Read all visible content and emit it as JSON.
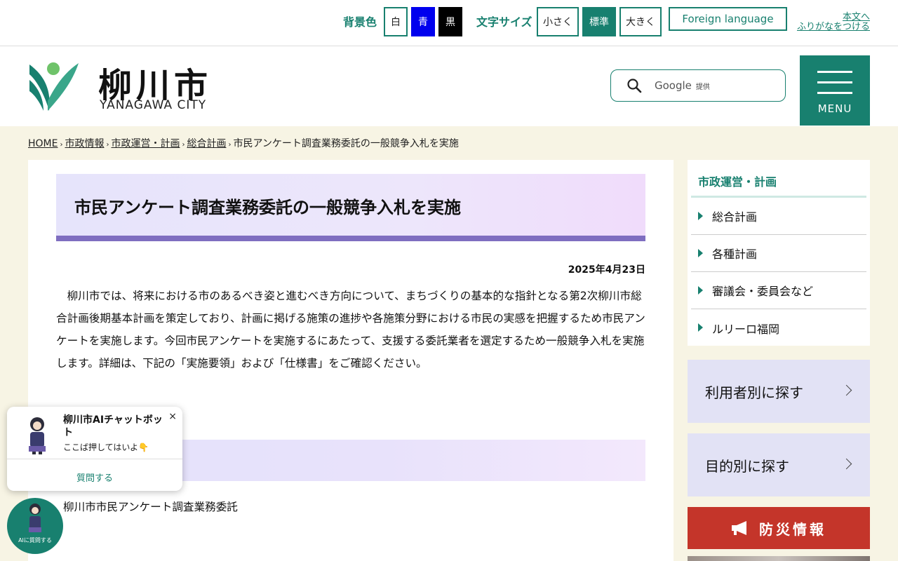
{
  "utility": {
    "bg_label": "背景色",
    "bg_white": "白",
    "bg_blue": "青",
    "bg_black": "黒",
    "font_label": "文字サイズ",
    "font_small": "小さく",
    "font_normal": "標準",
    "font_large": "大きく",
    "foreign": "Foreign language",
    "skip": "本文へ",
    "furigana": "ふりがなをつける"
  },
  "header": {
    "logo_text": "柳川市",
    "logo_sub": "YANAGAWA CITY",
    "search_brand": "Google",
    "search_powered": "提供",
    "menu": "MENU"
  },
  "breadcrumb": {
    "home": "HOME",
    "c1": "市政情報",
    "c2": "市政運営・計画",
    "c3": "総合計画",
    "current": "市民アンケート調査業務委託の一般競争入札を実施",
    "sep": "›"
  },
  "main": {
    "title": "市民アンケート調査業務委託の一般競争入札を実施",
    "date": "2025年4月23日",
    "body": "柳川市では、将来における市のあるべき姿と進むべき方向について、まちづくりの基本的な指針となる第2次柳川市総合計画後期基本計画を策定しており、計画に掲げる施策の進捗や各施策分野における市民の実感を把握するため市民アンケートを実施します。今回市民アンケートを実施するにあたって、支援する委託業者を選定するため一般競争入札を実施します。詳細は、下記の「実施要領」および「仕様書」をご確認ください。",
    "subtext": "柳川市市民アンケート調査業務委託"
  },
  "sidebar": {
    "heading": "市政運営・計画",
    "items": [
      {
        "label": "総合計画"
      },
      {
        "label": "各種計画"
      },
      {
        "label": "審議会・委員会など"
      },
      {
        "label": "ルリーロ福岡"
      }
    ],
    "by_user": "利用者別に探す",
    "by_purpose": "目的別に探す",
    "disaster": "防災情報"
  },
  "chat": {
    "title": "柳川市AIチャットボット",
    "message": "ここば押してはいよ👇",
    "close": "×",
    "ask": "質問する",
    "fab_label": "AIに質問する"
  },
  "colors": {
    "accent": "#18806f",
    "title_bar": "#7f6ec0",
    "disaster": "#c4352a",
    "page_bg": "#f7f4e4"
  }
}
